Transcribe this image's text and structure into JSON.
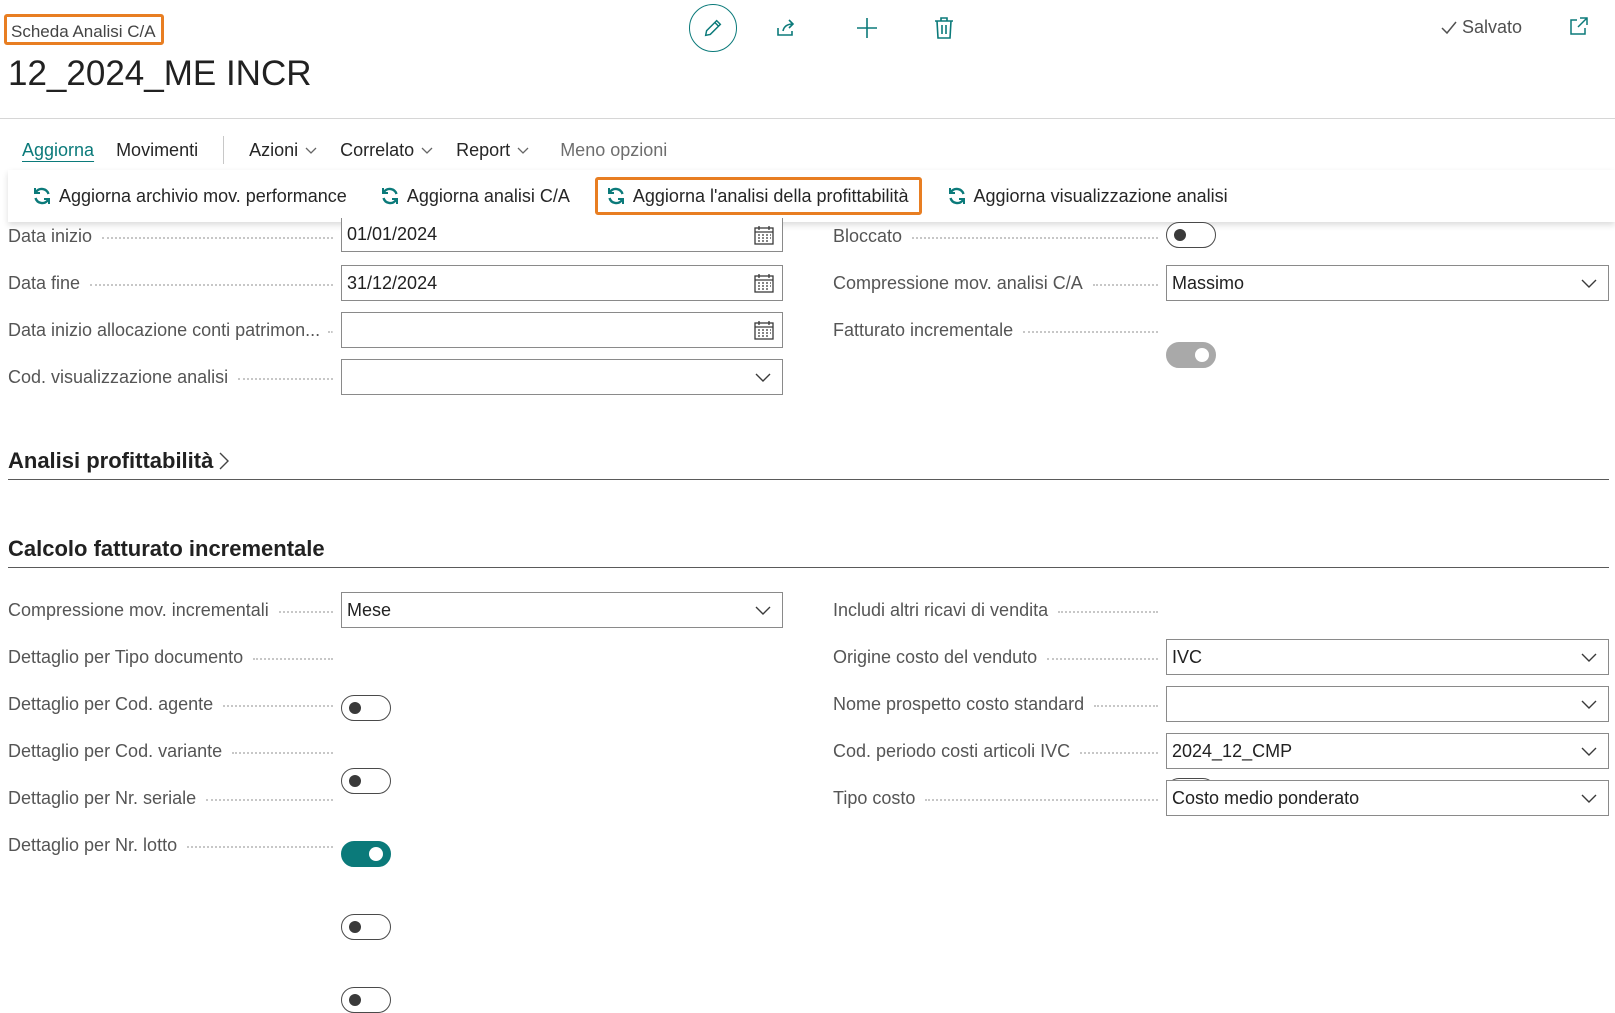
{
  "header": {
    "breadcrumb": "Scheda Analisi C/A",
    "title": "12_2024_ME INCR",
    "saved_label": "Salvato"
  },
  "toolbar": {
    "edit_icon": "pencil-icon",
    "share_icon": "share-icon",
    "add_icon": "plus-icon",
    "delete_icon": "trash-icon"
  },
  "menu": {
    "items": [
      {
        "label": "Aggiorna"
      },
      {
        "label": "Movimenti"
      },
      {
        "label": "Azioni"
      },
      {
        "label": "Correlato"
      },
      {
        "label": "Report"
      },
      {
        "label": "Meno opzioni"
      }
    ]
  },
  "actions": {
    "items": [
      {
        "label": "Aggiorna archivio mov. performance"
      },
      {
        "label": "Aggiorna analisi C/A"
      },
      {
        "label": "Aggiorna l'analisi della profittabilità"
      },
      {
        "label": "Aggiorna visualizzazione analisi"
      }
    ]
  },
  "general": {
    "data_inizio": {
      "label": "Data inizio",
      "value": "01/01/2024"
    },
    "data_fine": {
      "label": "Data fine",
      "value": "31/12/2024"
    },
    "data_alloc": {
      "label": "Data inizio allocazione conti patrimon...",
      "value": ""
    },
    "cod_visual": {
      "label": "Cod. visualizzazione analisi",
      "value": ""
    },
    "bloccato": {
      "label": "Bloccato",
      "value": false
    },
    "compressione": {
      "label": "Compressione mov. analisi C/A",
      "value": "Massimo"
    },
    "fatturato_incr": {
      "label": "Fatturato incrementale",
      "value": true
    }
  },
  "sections": {
    "profittabilita": "Analisi profittabilità",
    "calcolo": "Calcolo fatturato incrementale"
  },
  "calcolo": {
    "compressione_incr": {
      "label": "Compressione mov. incrementali",
      "value": "Mese"
    },
    "tipo_doc": {
      "label": "Dettaglio per Tipo documento",
      "value": false
    },
    "agente": {
      "label": "Dettaglio per Cod. agente",
      "value": false
    },
    "variante": {
      "label": "Dettaglio per Cod. variante",
      "value": true
    },
    "seriale": {
      "label": "Dettaglio per Nr. seriale",
      "value": false
    },
    "lotto": {
      "label": "Dettaglio per Nr. lotto",
      "value": false
    },
    "altri_ricavi": {
      "label": "Includi altri ricavi di vendita",
      "value": false
    },
    "origine_costo": {
      "label": "Origine costo del venduto",
      "value": "IVC"
    },
    "prospetto": {
      "label": "Nome prospetto costo standard",
      "value": ""
    },
    "periodo_ivc": {
      "label": "Cod. periodo costi articoli IVC",
      "value": "2024_12_CMP"
    },
    "tipo_costo": {
      "label": "Tipo costo",
      "value": "Costo medio ponderato"
    }
  },
  "colors": {
    "accent": "#0b7a7a",
    "highlight": "#e87e22"
  }
}
